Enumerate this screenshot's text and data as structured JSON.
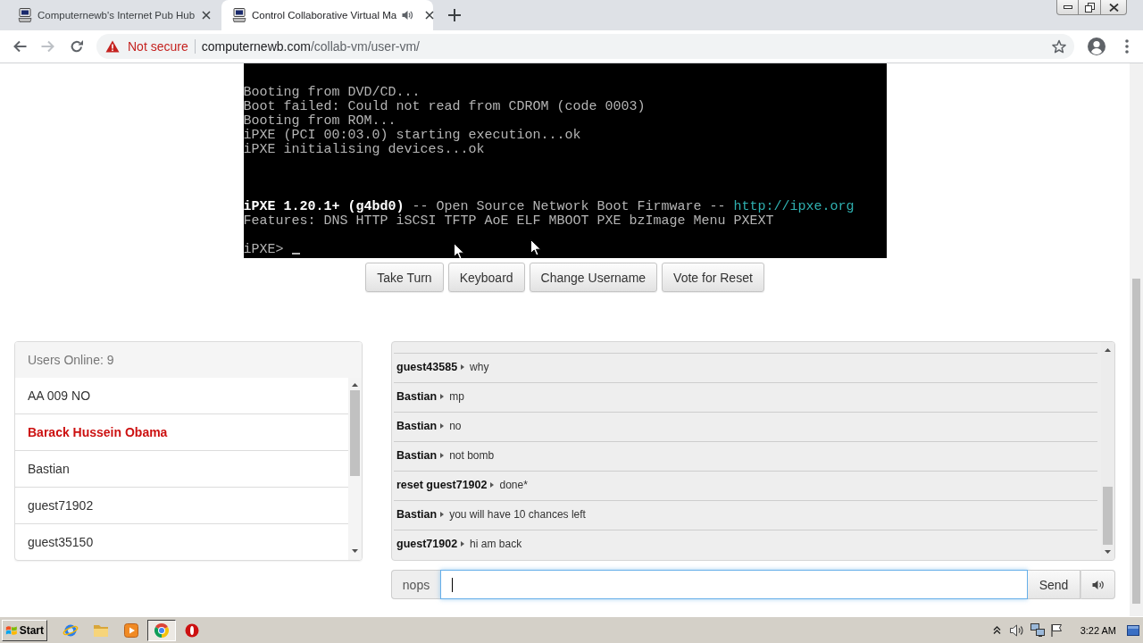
{
  "browser": {
    "tabs": [
      {
        "title": "Computernewb's Internet Pub Hub",
        "selected": false,
        "audio": false
      },
      {
        "title": "Control Collaborative Virtual Ma",
        "selected": true,
        "audio": true
      }
    ],
    "address": {
      "warning": "Not secure",
      "host": "computernewb.com",
      "path": "/collab-vm/user-vm/"
    }
  },
  "vm_screen": {
    "lines": [
      {
        "kind": "blank"
      },
      {
        "kind": "blank"
      },
      {
        "kind": "text",
        "segments": [
          {
            "text": "Booting from DVD/CD...",
            "kind": "normal"
          }
        ]
      },
      {
        "kind": "text",
        "segments": [
          {
            "text": "Boot failed: Could not read from CDROM (code 0003)",
            "kind": "normal"
          }
        ]
      },
      {
        "kind": "text",
        "segments": [
          {
            "text": "Booting from ROM...",
            "kind": "normal"
          }
        ]
      },
      {
        "kind": "text",
        "segments": [
          {
            "text": "iPXE (PCI 00:03.0) starting execution...ok",
            "kind": "normal"
          }
        ]
      },
      {
        "kind": "text",
        "segments": [
          {
            "text": "iPXE initialising devices...ok",
            "kind": "normal"
          }
        ]
      },
      {
        "kind": "blank"
      },
      {
        "kind": "blank"
      },
      {
        "kind": "blank"
      },
      {
        "kind": "text",
        "segments": [
          {
            "text": "iPXE 1.20.1+ (g4bd0)",
            "kind": "bright"
          },
          {
            "text": " -- Open Source Network Boot Firmware -- ",
            "kind": "normal"
          },
          {
            "text": "http://ipxe.org",
            "kind": "link"
          }
        ]
      },
      {
        "kind": "text",
        "segments": [
          {
            "text": "Features: DNS HTTP iSCSI TFTP AoE ELF MBOOT PXE bzImage Menu PXEXT",
            "kind": "normal"
          }
        ]
      },
      {
        "kind": "blank"
      },
      {
        "kind": "prompt",
        "segments": [
          {
            "text": "iPXE>",
            "kind": "normal"
          }
        ]
      }
    ]
  },
  "vm_controls": [
    "Take Turn",
    "Keyboard",
    "Change Username",
    "Vote for Reset"
  ],
  "users_panel": {
    "header": "Users Online: 9",
    "users": [
      {
        "name": "AA 009 NO",
        "highlighted": false
      },
      {
        "name": "Barack Hussein Obama",
        "highlighted": true
      },
      {
        "name": "Bastian",
        "highlighted": false
      },
      {
        "name": "guest71902",
        "highlighted": false
      },
      {
        "name": "guest35150",
        "highlighted": false
      }
    ]
  },
  "chat": {
    "messages": [
      {
        "user": "guest43585",
        "text": "why"
      },
      {
        "user": "Bastian",
        "text": "mp"
      },
      {
        "user": "Bastian",
        "text": "no"
      },
      {
        "user": "Bastian",
        "text": "not bomb"
      },
      {
        "user": "reset guest71902",
        "text": "done*"
      },
      {
        "user": "Bastian",
        "text": "you will have 10 chances left"
      },
      {
        "user": "guest71902",
        "text": "hi am back"
      }
    ],
    "input": {
      "username": "nops",
      "focused": true
    },
    "send_label": "Send"
  },
  "taskbar": {
    "start_label": "Start",
    "apps": [
      {
        "kind": "globe",
        "selected": false
      },
      {
        "kind": "folder",
        "selected": false
      },
      {
        "kind": "player",
        "selected": false
      },
      {
        "kind": "browser",
        "selected": true
      },
      {
        "kind": "ring",
        "selected": false
      }
    ],
    "clock": "3:22 AM"
  }
}
